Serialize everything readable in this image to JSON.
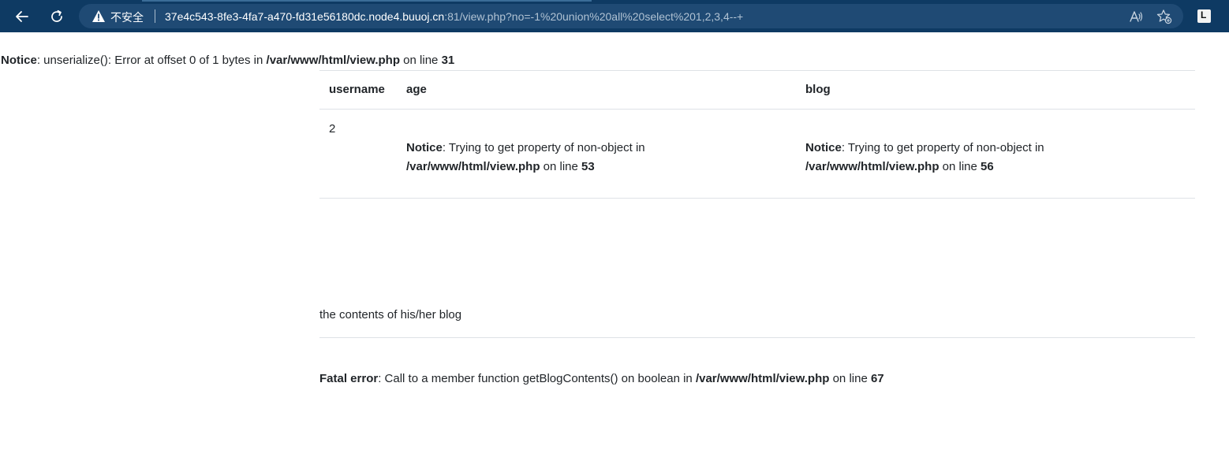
{
  "browser": {
    "security_label": "不安全",
    "url_host": "37e4c543-8fe3-4fa7-a470-fd31e56180dc.node4.buuoj.cn",
    "url_rest": ":81/view.php?no=-1%20union%20all%20select%201,2,3,4--+"
  },
  "top_notice": {
    "label": "Notice",
    "message": ": unserialize(): Error at offset 0 of 1 bytes in ",
    "path": "/var/www/html/view.php",
    "on_line": " on line ",
    "line": "31"
  },
  "table": {
    "headers": [
      "username",
      "age",
      "blog"
    ],
    "username_value": "2",
    "age_notice": {
      "label": "Notice",
      "message": ": Trying to get property of non-object in",
      "path": "/var/www/html/view.php",
      "on_line": " on line ",
      "line": "53"
    },
    "blog_notice": {
      "label": "Notice",
      "message": ": Trying to get property of non-object in",
      "path": "/var/www/html/view.php",
      "on_line": " on line ",
      "line": "56"
    }
  },
  "blog_contents": "the contents of his/her blog",
  "fatal_error": {
    "label": "Fatal error",
    "message": ": Call to a member function getBlogContents() on boolean in ",
    "path": "/var/www/html/view.php",
    "on_line": " on line ",
    "line": "67"
  },
  "icons": {
    "back": "back-arrow-icon",
    "reload": "reload-icon",
    "warning": "warning-triangle-icon",
    "read_aloud": "read-aloud-icon",
    "favorite": "add-favorite-icon",
    "extension": "extension-icon"
  }
}
